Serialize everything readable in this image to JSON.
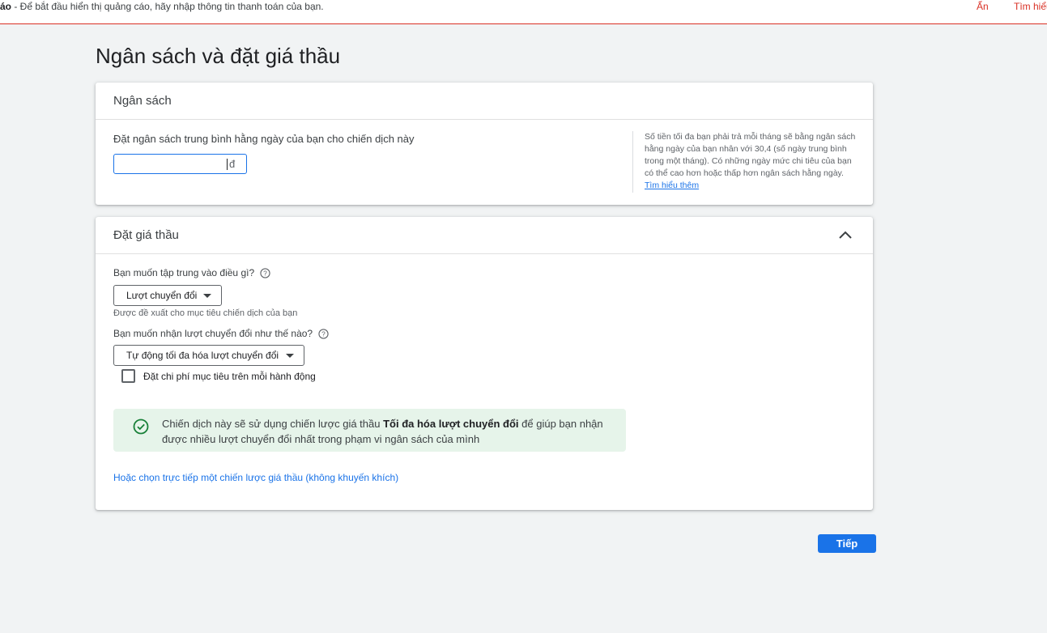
{
  "banner": {
    "prefix": "áo",
    "message": " - Để bắt đầu hiển thị quảng cáo, hãy nhập thông tin thanh toán của bạn.",
    "hide_label": "Ẩn",
    "learn_label": "Tìm hiểu thêm",
    "accent_color": "#d93025"
  },
  "page": {
    "title": "Ngân sách và đặt giá thầu"
  },
  "budget": {
    "title": "Ngân sách",
    "label": "Đặt ngân sách trung bình hằng ngày của bạn cho chiến dịch này",
    "input_value": "",
    "currency": "đ",
    "aside_text": "Số tiền tối đa bạn phải trả mỗi tháng sẽ bằng ngân sách hằng ngày của bạn nhân với 30,4 (số ngày trung bình trong một tháng). Có những ngày mức chi tiêu của bạn có thể cao hơn hoặc thấp hơn ngân sách hằng ngày.",
    "aside_link": "Tìm hiểu thêm"
  },
  "bidding": {
    "title": "Đặt giá thầu",
    "collapse_icon": "chevron-up-icon",
    "focus_question": "Bạn muốn tập trung vào điều gì?",
    "focus_value": "Lượt chuyển đổi",
    "focus_hint": "Được đề xuất cho mục tiêu chiến dịch của bạn",
    "how_question": "Bạn muốn nhận lượt chuyển đổi như thế nào?",
    "how_value": "Tự động tối đa hóa lượt chuyển đổi",
    "target_cost_label": "Đặt chi phí mục tiêu trên mỗi hành động",
    "target_cost_checked": false,
    "notice_prefix": "Chiến dịch này sẽ sử dụng chiến lược giá thầu ",
    "notice_strategy": "Tối đa hóa lượt chuyển đổi",
    "notice_suffix": " để giúp bạn nhận được nhiều lượt chuyển đổi nhất trong phạm vi ngân sách của mình",
    "notice_color": "#e6f4ea",
    "alt_link": "Hoặc chọn trực tiếp một chiến lược giá thầu (không khuyến khích)"
  },
  "footer": {
    "next_label": "Tiếp",
    "accent_color": "#1a73e8"
  }
}
